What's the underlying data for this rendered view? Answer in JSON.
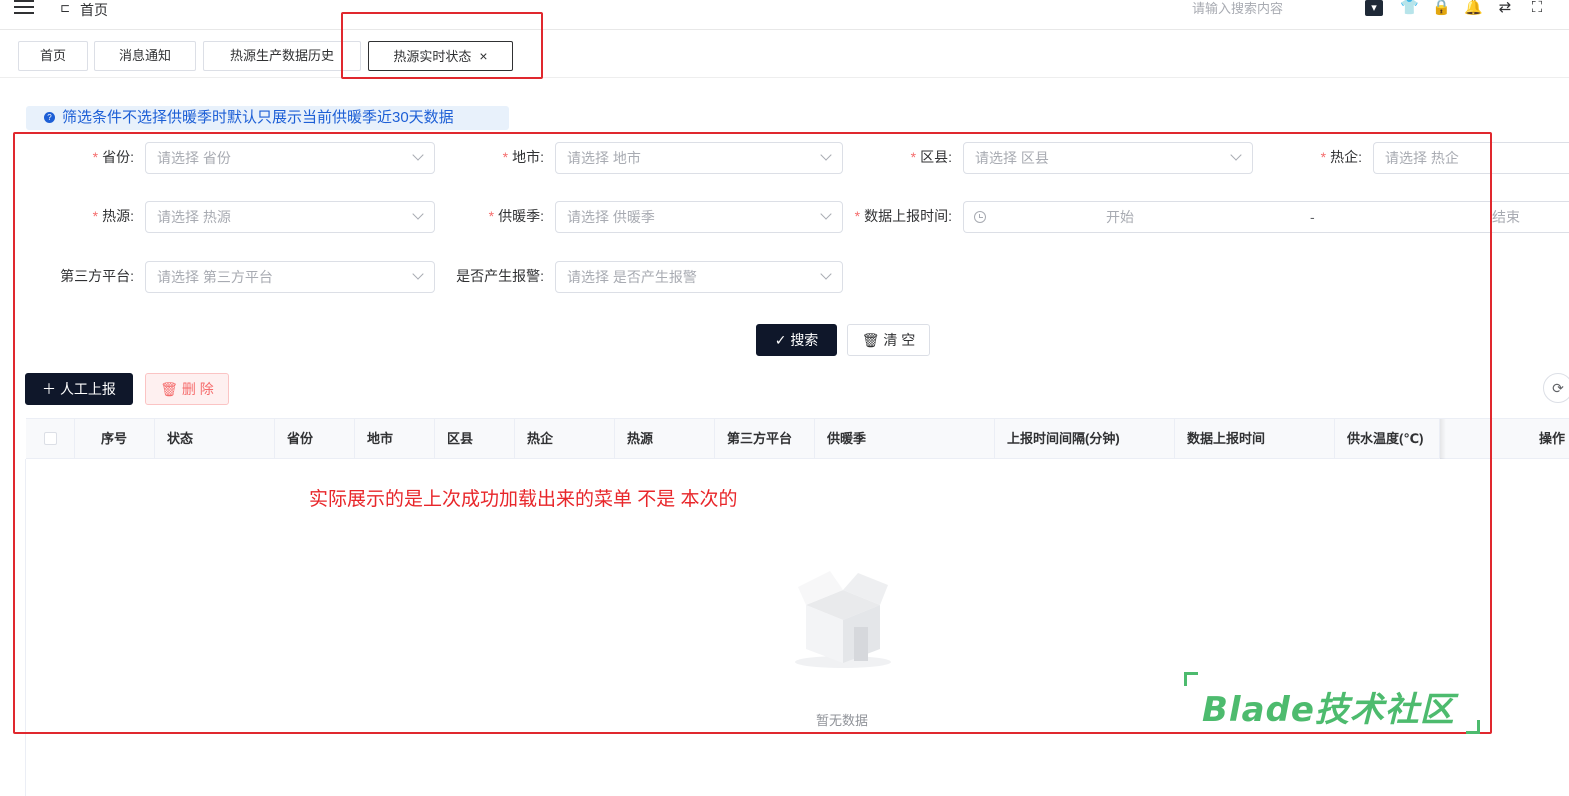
{
  "header": {
    "breadcrumb": "首页",
    "search_placeholder": "请输入搜索内容",
    "icons": [
      "menu-icon",
      "breadcrumb-icon",
      "theme-icon",
      "shirt-icon",
      "lock-icon",
      "bell-icon",
      "translate-icon",
      "fullscreen-icon"
    ]
  },
  "tabs": [
    {
      "label": "首页"
    },
    {
      "label": "消息通知"
    },
    {
      "label": "热源生产数据历史"
    },
    {
      "label": "热源实时状态",
      "active": true,
      "close": "×"
    }
  ],
  "notice": {
    "text": "筛选条件不选择供暖季时默认只展示当前供暖季近30天数据",
    "icon": "?"
  },
  "filters": {
    "province": {
      "label": "省份:",
      "placeholder": "请选择 省份",
      "required": "*"
    },
    "city": {
      "label": "地市:",
      "placeholder": "请选择 地市",
      "required": "*"
    },
    "county": {
      "label": "区县:",
      "placeholder": "请选择 区县",
      "required": "*"
    },
    "enterprise": {
      "label": "热企:",
      "placeholder": "请选择 热企",
      "required": "*"
    },
    "source": {
      "label": "热源:",
      "placeholder": "请选择 热源",
      "required": "*"
    },
    "season": {
      "label": "供暖季:",
      "placeholder": "请选择 供暖季",
      "required": "*"
    },
    "report_time": {
      "label": "数据上报时间:",
      "start": "开始",
      "sep": "-",
      "end": "结束",
      "required": "*"
    },
    "platform": {
      "label": "第三方平台:",
      "placeholder": "请选择 第三方平台"
    },
    "alarm": {
      "label": "是否产生报警:",
      "placeholder": "请选择 是否产生报警"
    }
  },
  "actions": {
    "search": "搜索",
    "clear": "清 空",
    "manual_report": "人工上报",
    "delete": "删 除"
  },
  "table": {
    "columns": [
      "序号",
      "状态",
      "省份",
      "地市",
      "区县",
      "热企",
      "热源",
      "第三方平台",
      "供暖季",
      "上报时间间隔(分钟)",
      "数据上报时间",
      "供水温度(℃)",
      "操作"
    ],
    "empty_text": "暂无数据"
  },
  "annotation": {
    "text": "实际展示的是上次成功加载出来的菜单 不是 本次的",
    "color": "#e8262a"
  },
  "watermark": {
    "text": "Blade技术社区",
    "color": "#4dbb6e"
  },
  "colors": {
    "primary_dark": "#0f172a",
    "danger": "#f56c6c",
    "notice_blue": "#1d5fd6",
    "annotation_red": "#e0282e"
  }
}
